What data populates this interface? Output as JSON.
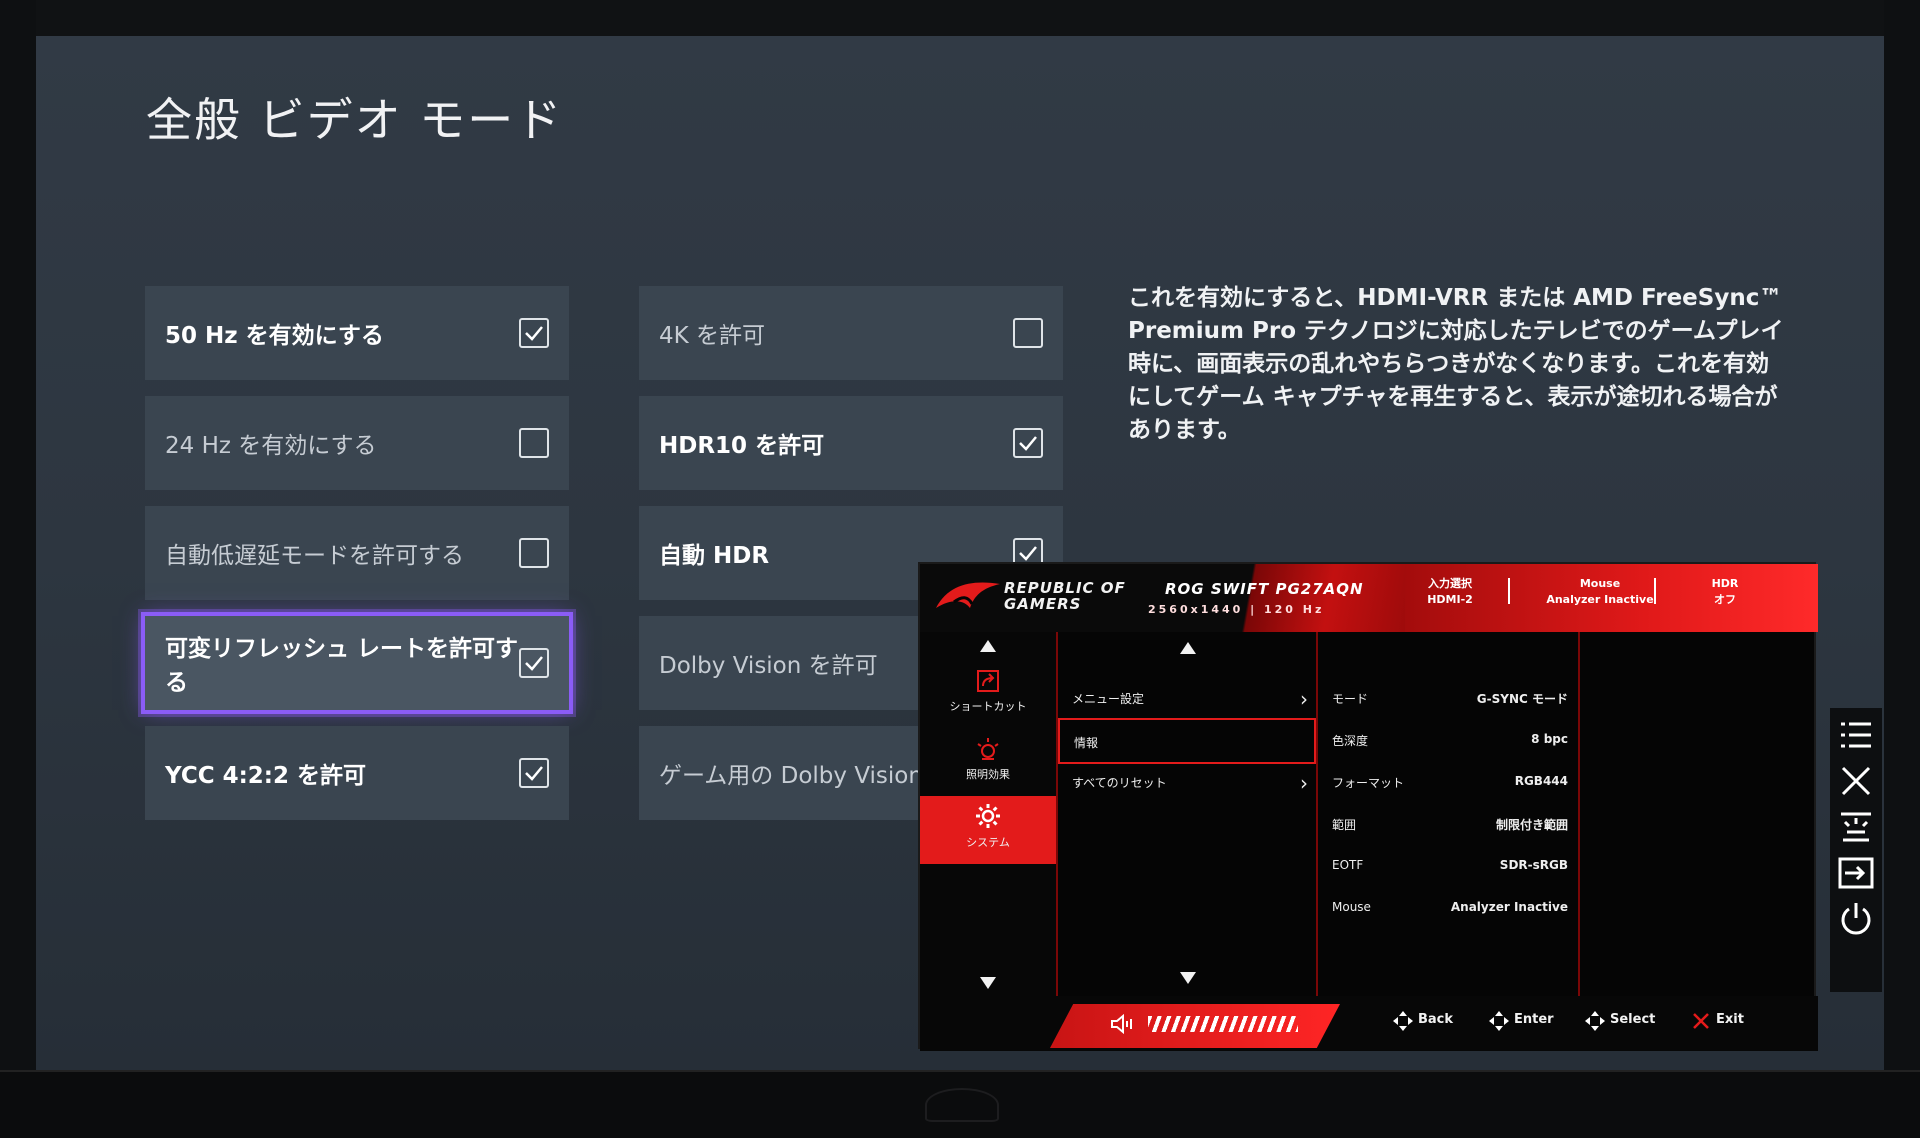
{
  "page": {
    "title": "全般 ビデオ モード"
  },
  "options": {
    "left": [
      {
        "label": "50 Hz を有効にする",
        "checked": true
      },
      {
        "label": "24 Hz を有効にする",
        "checked": false
      },
      {
        "label": "自動低遅延モードを許可する",
        "checked": false
      },
      {
        "label": "可変リフレッシュ レートを許可する",
        "checked": true,
        "focused": true
      },
      {
        "label": "YCC 4:2:2 を許可",
        "checked": true
      }
    ],
    "right": [
      {
        "label": "4K を許可",
        "checked": false
      },
      {
        "label": "HDR10 を許可",
        "checked": true
      },
      {
        "label": "自動 HDR",
        "checked": true
      },
      {
        "label": "Dolby Vision を許可",
        "checked": false
      },
      {
        "label": "ゲーム用の Dolby Vision",
        "checked": false
      }
    ]
  },
  "description": "これを有効にすると、HDMI-VRR または AMD FreeSync™ Premium Pro テクノロジに対応したテレビでのゲームプレイ時に、画面表示の乱れやちらつきがなくなります。これを有効にしてゲーム キャプチャを再生すると、表示が途切れる場合があります。",
  "osd": {
    "brand": [
      "REPUBLIC OF",
      "GAMERS"
    ],
    "model": "ROG SWIFT PG27AQN",
    "resolution": "2560x1440 | 120 Hz",
    "header": [
      {
        "top": "入力選択",
        "bottom": "HDMI-2"
      },
      {
        "top": "Mouse",
        "bottom": "Analyzer Inactive"
      },
      {
        "top": "HDR",
        "bottom": "オフ"
      }
    ],
    "side": [
      {
        "label": "ショートカット",
        "icon": "shortcut-icon"
      },
      {
        "label": "照明効果",
        "icon": "lighting-icon"
      },
      {
        "label": "システム",
        "icon": "gear-icon",
        "active": true
      }
    ],
    "menu": [
      {
        "label": "メニュー設定",
        "has_sub": true
      },
      {
        "label": "情報",
        "selected": true
      },
      {
        "label": "すべてのリセット",
        "has_sub": true
      }
    ],
    "info": [
      {
        "key": "モード",
        "value": "G-SYNC モード"
      },
      {
        "key": "色深度",
        "value": "8 bpc"
      },
      {
        "key": "フォーマット",
        "value": "RGB444"
      },
      {
        "key": "範囲",
        "value": "制限付き範囲"
      },
      {
        "key": "EOTF",
        "value": "SDR-sRGB"
      },
      {
        "key": "Mouse",
        "value": "Analyzer Inactive"
      }
    ],
    "footer": [
      "Back",
      "Enter",
      "Select",
      "Exit"
    ],
    "accent": "#e31b1b"
  },
  "rail_icons": [
    "menu-icon",
    "close-icon",
    "brightness-icon",
    "input-icon",
    "power-icon"
  ]
}
